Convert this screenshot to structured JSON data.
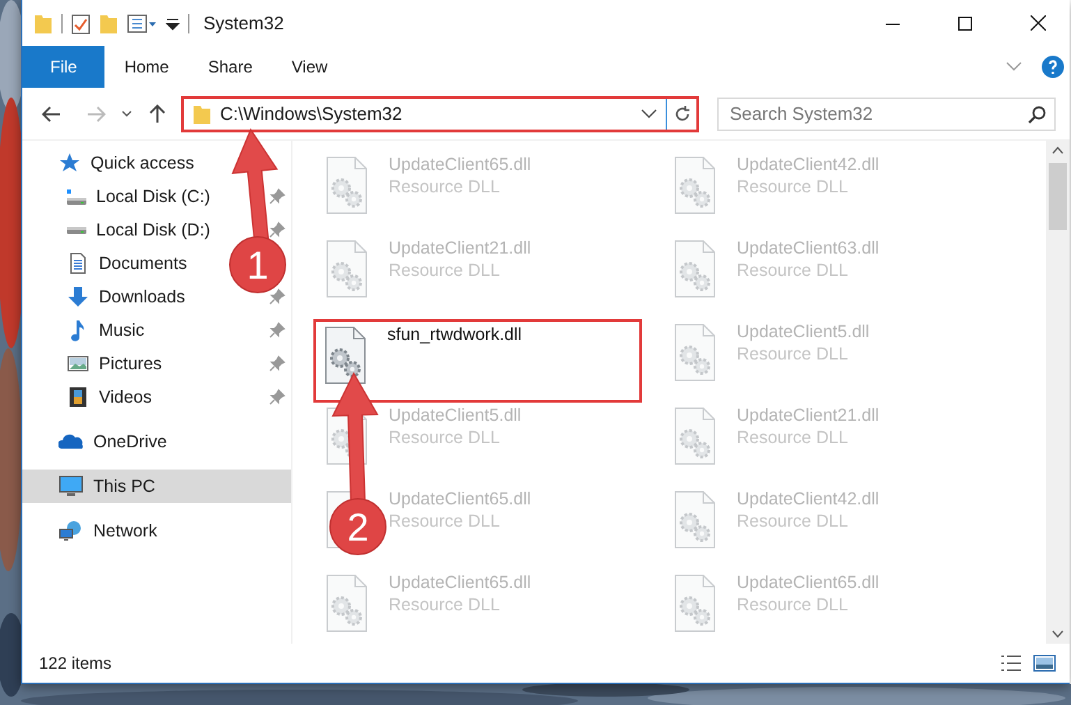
{
  "window": {
    "title": "System32"
  },
  "ribbon_tabs": [
    {
      "label": "File",
      "kind": "menu"
    },
    {
      "label": "Home",
      "kind": "tab"
    },
    {
      "label": "Share",
      "kind": "tab"
    },
    {
      "label": "View",
      "kind": "tab"
    }
  ],
  "address_bar": {
    "path": "C:\\Windows\\System32",
    "highlighted": true
  },
  "search": {
    "placeholder": "Search System32"
  },
  "sidebar": {
    "items": [
      {
        "label": "Quick access",
        "kind": "quick_access",
        "selected": false,
        "children": [
          {
            "label": "Local Disk (C:)",
            "kind": "system_drive",
            "selected": false,
            "pinned": true
          },
          {
            "label": "Local Disk (D:)",
            "kind": "drive",
            "selected": false,
            "pinned": true
          },
          {
            "label": "Documents",
            "kind": "documents",
            "selected": false
          },
          {
            "label": "Downloads",
            "kind": "downloads",
            "selected": false,
            "pinned": true
          },
          {
            "label": "Music",
            "kind": "music",
            "selected": false,
            "pinned": true
          },
          {
            "label": "Pictures",
            "kind": "pictures",
            "selected": false,
            "pinned": true
          },
          {
            "label": "Videos",
            "kind": "videos",
            "selected": false,
            "pinned": true
          }
        ]
      },
      {
        "label": "OneDrive",
        "kind": "cloud",
        "selected": false
      },
      {
        "label": "This PC",
        "kind": "pc",
        "selected": true
      },
      {
        "label": "Network",
        "kind": "network",
        "selected": false
      }
    ]
  },
  "files": [
    {
      "name": "UpdateClient65.dll",
      "type": "Resource DLL",
      "highlighted": false
    },
    {
      "name": "UpdateClient42.dll",
      "type": "Resource DLL",
      "highlighted": false
    },
    {
      "name": "UpdateClient21.dll",
      "type": "Resource DLL",
      "highlighted": false
    },
    {
      "name": "UpdateClient63.dll",
      "type": "Resource DLL",
      "highlighted": false
    },
    {
      "name": "sfun_rtwdwork.dll",
      "highlighted": true
    },
    {
      "name": "UpdateClient5.dll",
      "type": "Resource DLL",
      "highlighted": false
    },
    {
      "name": "UpdateClient5.dll",
      "type": "Resource DLL",
      "highlighted": false
    },
    {
      "name": "UpdateClient21.dll",
      "type": "Resource DLL",
      "highlighted": false
    },
    {
      "name": "UpdateClient65.dll",
      "type": "Resource DLL",
      "highlighted": false
    },
    {
      "name": "UpdateClient42.dll",
      "type": "Resource DLL",
      "highlighted": false
    },
    {
      "name": "UpdateClient65.dll",
      "type": "Resource DLL",
      "highlighted": false
    },
    {
      "name": "UpdateClient65.dll",
      "type": "Resource DLL",
      "highlighted": false
    }
  ],
  "status_bar": {
    "item_count": "122 items"
  },
  "annotations": [
    {
      "number": "1"
    },
    {
      "number": "2"
    }
  ]
}
